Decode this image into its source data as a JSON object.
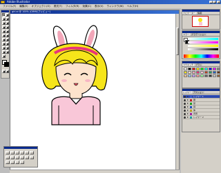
{
  "window": {
    "title": "Adobe Illustrator",
    "controls": [
      "_",
      "□",
      "×"
    ]
  },
  "menubar": {
    "items": [
      "ファイル(F)",
      "編集(E)",
      "オブジェクト(O)",
      "書式(T)",
      "フィルタ(R)",
      "効果(C)",
      "表示(V)",
      "ウィンドウ(W)",
      "ヘルプ(H)"
    ]
  },
  "document": {
    "title": "girl.ai @ 100% (CMYK/プレビュー)"
  },
  "panels": {
    "navigator": {
      "tabs": [
        "ナビゲーター",
        "情報"
      ]
    },
    "color": {
      "tabs": [
        "カラー",
        "グラデーション"
      ]
    },
    "swatches": {
      "tabs": [
        "スウォッチ",
        "ブラシ"
      ]
    },
    "layers": {
      "tabs": [
        "レイヤー",
        "アクション"
      ],
      "rows": [
        {
          "name": "レイヤー 1",
          "selected": true,
          "color": "#3a5bd0"
        },
        {
          "name": "顔",
          "selected": false,
          "color": "#c02020"
        },
        {
          "name": "髪",
          "selected": false,
          "color": "#20a020"
        },
        {
          "name": "耳",
          "selected": false,
          "color": "#2050c0"
        },
        {
          "name": "体",
          "selected": false,
          "color": "#c0a020"
        },
        {
          "name": "背景",
          "selected": false,
          "color": "#a020a0"
        },
        {
          "name": "レイヤー 2",
          "selected": false,
          "color": "#20a0a0"
        }
      ]
    }
  },
  "colors": {
    "hair": "#f6e51a",
    "skin": "#fde3cc",
    "ears_inner": "#f2a6b8",
    "headband": "#e8347a",
    "shirt": "#f9c7d8",
    "outline": "#000000"
  },
  "swatch_colors": [
    "#ffffff",
    "#000000",
    "#ff0000",
    "#ffff00",
    "#00ff00",
    "#00ffff",
    "#0000ff",
    "#ff00ff",
    "#888888",
    "#f6e51a",
    "#fde3cc",
    "#f2a6b8",
    "#e8347a",
    "#f9c7d8",
    "#c04020",
    "#20a060",
    "#2060c0",
    "#603010",
    "#ffcc99",
    "#99ccff",
    "#cc99ff",
    "#ff9999",
    "#99ff99",
    "#666666",
    "#333333",
    "#cccccc",
    "#996633"
  ]
}
